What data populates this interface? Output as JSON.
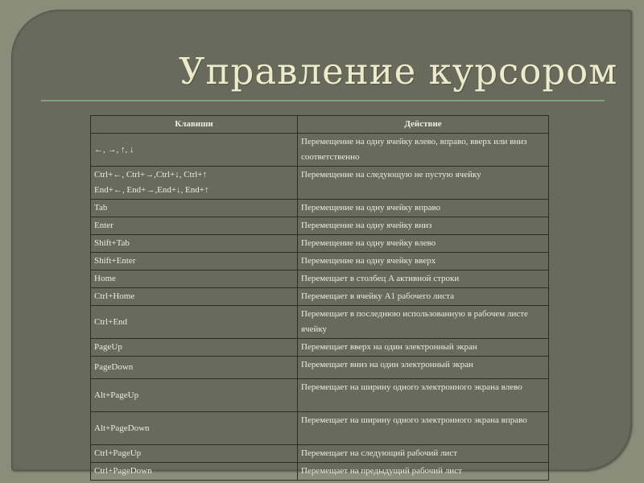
{
  "title": "Управление курсором",
  "table": {
    "headers": [
      "Клавиши",
      "Действие"
    ],
    "rows": [
      {
        "keys": "←, →, ↑, ↓",
        "keys2": "",
        "action": "Перемещение на одну ячейку влево, вправо, вверх или вниз соответственно"
      },
      {
        "keys": "Ctrl+←, Ctrl+→,Ctrl+↓, Ctrl+↑",
        "keys2": "End+←, End+→,End+↓, End+↑",
        "action": "Перемещение на следующую не пустую ячейку"
      },
      {
        "keys": "Tab",
        "keys2": "",
        "action": "Перемещение на одну ячейку вправо"
      },
      {
        "keys": "Enter",
        "keys2": "",
        "action": "Перемещение на одну ячейку вниз"
      },
      {
        "keys": "Shift+Tab",
        "keys2": "",
        "action": "Перемещение на одну ячейку влево"
      },
      {
        "keys": "Shift+Enter",
        "keys2": "",
        "action": "Перемещение на одну ячейку вверх"
      },
      {
        "keys": "Home",
        "keys2": "",
        "action": "Перемещает в столбец A активной строки"
      },
      {
        "keys": "Ctrl+Home",
        "keys2": "",
        "action": "Перемещает в ячейку A1 рабочего листа"
      },
      {
        "keys": "Ctrl+End",
        "keys2": "",
        "action": "Перемещает в последнюю использованную в рабочем листе ячейку"
      },
      {
        "keys": "PageUp",
        "keys2": "",
        "action": "Перемещает вверх на один электронный экран"
      },
      {
        "keys": "PageDown",
        "keys2": "",
        "action": "Перемещает вниз на один электронный экран"
      },
      {
        "keys": "Alt+PageUp",
        "keys2": "",
        "action": "Перемещает на ширину одного электронного экрана влево"
      },
      {
        "keys": "Alt+PageDown",
        "keys2": "",
        "action": "Перемещает на ширину одного электронного экрана вправо"
      },
      {
        "keys": "Ctrl+PageUp",
        "keys2": "",
        "action": "Перемещает на следующий рабочий лист"
      },
      {
        "keys": "Ctrl+PageDown",
        "keys2": "",
        "action": "Перемещает на предыдущий рабочий лист"
      }
    ]
  }
}
